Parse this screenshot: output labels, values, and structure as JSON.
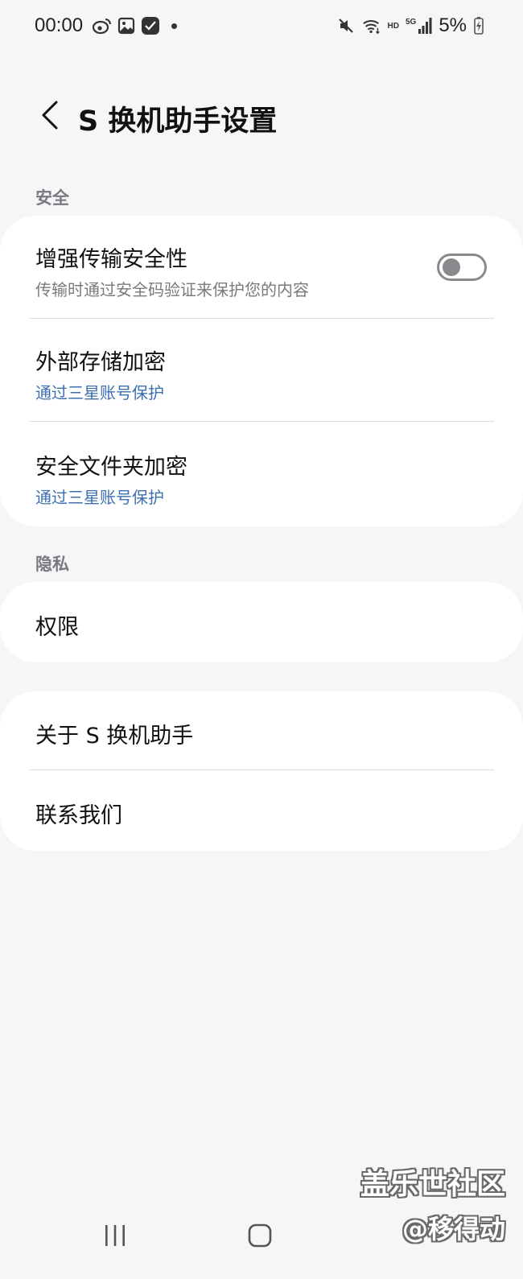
{
  "status_bar": {
    "time": "00:00",
    "battery": "5%",
    "network_hd": "HD",
    "network_5g": "5G",
    "left_icons": [
      "weibo-icon",
      "gallery-icon",
      "app-badge-icon",
      "notification-dot-icon"
    ],
    "right_icons": [
      "mute-icon",
      "wifi-icon",
      "signal-icon",
      "battery-charging-icon"
    ]
  },
  "header": {
    "title": "S 换机助手设置",
    "back_icon": "chevron-left-icon"
  },
  "sections": {
    "security_label": "安全",
    "privacy_label": "隐私"
  },
  "security": {
    "enhance_title": "增强传输安全性",
    "enhance_sub": "传输时通过安全码验证来保护您的内容",
    "enhance_enabled": false,
    "external_title": "外部存储加密",
    "external_sub": "通过三星账号保护",
    "folder_title": "安全文件夹加密",
    "folder_sub": "通过三星账号保护"
  },
  "privacy": {
    "permissions_title": "权限"
  },
  "about": {
    "about_title": "关于 S 换机助手",
    "contact_title": "联系我们"
  },
  "watermark": {
    "line1": "盖乐世社区",
    "line2": "@移得动"
  },
  "colors": {
    "background": "#f6f6f8",
    "card": "#ffffff",
    "accent_blue": "#3c6fb0",
    "secondary_text": "#7a7a7e"
  }
}
